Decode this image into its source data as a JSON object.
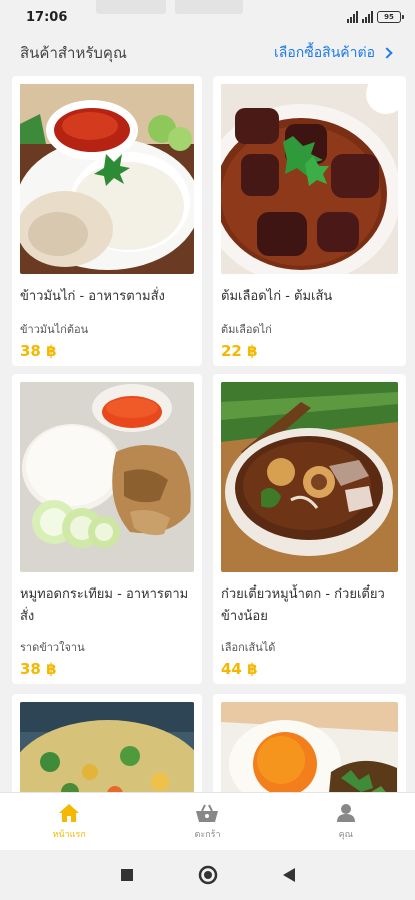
{
  "status": {
    "time": "17:06",
    "battery": "95"
  },
  "section": {
    "title": "สินค้าสำหรับคุณ",
    "see_more": "เลือกซื้อสินค้าต่อ"
  },
  "products": [
    {
      "name": "ข้าวมันไก่ - อาหารตามสั่ง",
      "option": "ข้าวมันไก่ต้อน",
      "price": "38 ฿"
    },
    {
      "name": "ต้มเลือดไก่ - ต้มเส้น",
      "option": "ต้มเลือดไก่",
      "price": "22 ฿"
    },
    {
      "name": "หมูทอดกระเทียม - อาหารตามสั่ง",
      "option": "ราดข้าวใจาน",
      "price": "38 ฿"
    },
    {
      "name": "ก๋วยเตี๋ยวหมูน้ำตก - ก๋วยเตี๋ยวข้างน้อย",
      "option": "เลือกเส้นได้",
      "price": "44 ฿"
    },
    {
      "name": "",
      "option": "",
      "price": ""
    },
    {
      "name": "",
      "option": "",
      "price": ""
    }
  ],
  "nav": [
    {
      "label": "หน้าแรก",
      "icon": "home-icon",
      "active": true
    },
    {
      "label": "ตะกร้า",
      "icon": "basket-icon",
      "active": false
    },
    {
      "label": "คุณ",
      "icon": "person-icon",
      "active": false
    }
  ],
  "colors": {
    "accent": "#f5b800",
    "link": "#1f7ce8"
  }
}
